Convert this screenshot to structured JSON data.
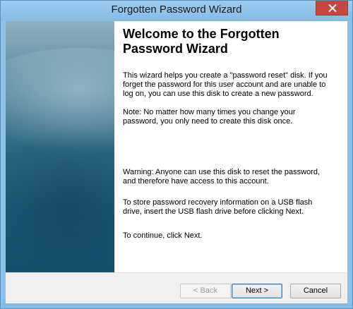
{
  "window": {
    "title": "Forgotten Password Wizard",
    "close_icon": "close-icon"
  },
  "main": {
    "heading": "Welcome to the Forgotten Password Wizard",
    "paragraphs": [
      "This wizard helps you create a \"password reset\" disk. If you forget the password for this user account and are unable to log on, you can use this disk to create a new password.",
      "Note: No matter how many times you change your password, you only need to create this disk once.",
      "Warning: Anyone can use this disk to reset the password, and therefore have access to this account.",
      "To store password recovery information on a USB flash drive, insert the USB flash drive before clicking Next.",
      "To continue, click Next."
    ]
  },
  "buttons": {
    "back": "< Back",
    "next": "Next >",
    "cancel": "Cancel"
  },
  "colors": {
    "title_bar": "#8ec1e8",
    "close_button": "#c7463d",
    "side_panel": "#2f6884"
  }
}
